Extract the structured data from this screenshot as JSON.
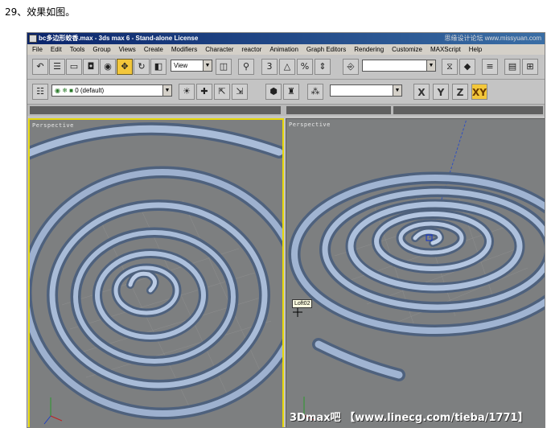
{
  "caption": "29、效果如图。",
  "window": {
    "title": "bc多边形蛟香.max - 3ds max 6 - Stand-alone License",
    "watermark": "思缘设计论坛 www.missyuan.com"
  },
  "menu": [
    "File",
    "Edit",
    "Tools",
    "Group",
    "Views",
    "Create",
    "Modifiers",
    "Character",
    "reactor",
    "Animation",
    "Graph Editors",
    "Rendering",
    "Customize",
    "MAXScript",
    "Help"
  ],
  "toolbar1": {
    "view_dropdown": "View",
    "selection_dropdown": ""
  },
  "toolbar2": {
    "layer_dropdown": "0 (default)",
    "pattern_dropdown": "",
    "axes": [
      "X",
      "Y",
      "Z",
      "XY"
    ],
    "active_axis": "XY"
  },
  "viewports": {
    "left_label": "Perspective",
    "right_label": "Perspective",
    "object_tooltip": "Loft02"
  },
  "watermark_bottom": "3Dmax吧 【www.linecg.com/tieba/1771】",
  "colors": {
    "viewport_bg": "#7d7f80",
    "spiral_light": "#a9bcd8",
    "spiral_mid": "#7f95b5",
    "spiral_dark": "#4e617d",
    "active_border": "#e6d70a",
    "active_button": "#f3c73a"
  }
}
